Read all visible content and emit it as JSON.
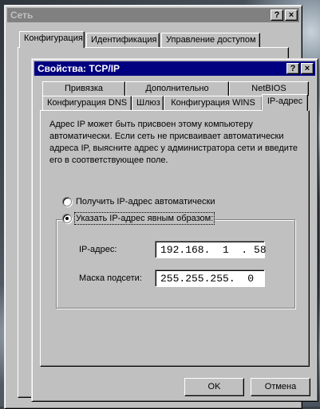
{
  "back_window": {
    "title": "Сеть",
    "tabs": [
      "Конфигурация",
      "Идентификация",
      "Управление доступом"
    ]
  },
  "dialog": {
    "title": "Свойства: TCP/IP",
    "tabs_row1": [
      "Привязка",
      "Дополнительно",
      "NetBIOS"
    ],
    "tabs_row2": [
      "Конфигурация DNS",
      "Шлюз",
      "Конфигурация WINS",
      "IP-адрес"
    ],
    "description": "Адрес IP может быть присвоен этому компьютеру автоматически. Если сеть не присваивает автоматически адреса IP, выясните адрес у администратора сети и введите его в соответствующее поле.",
    "radio_auto": "Получить IP-адрес автоматически",
    "radio_manual": "Указать IP-адрес явным образом:",
    "ip_label": "IP-адрес:",
    "ip_value": "192.168.  1  . 58",
    "mask_label": "Маска подсети:",
    "mask_value": "255.255.255.  0",
    "ok_label": "OK",
    "cancel_label": "Отмена"
  },
  "titlebar_buttons": {
    "help": "?",
    "close": "×"
  }
}
